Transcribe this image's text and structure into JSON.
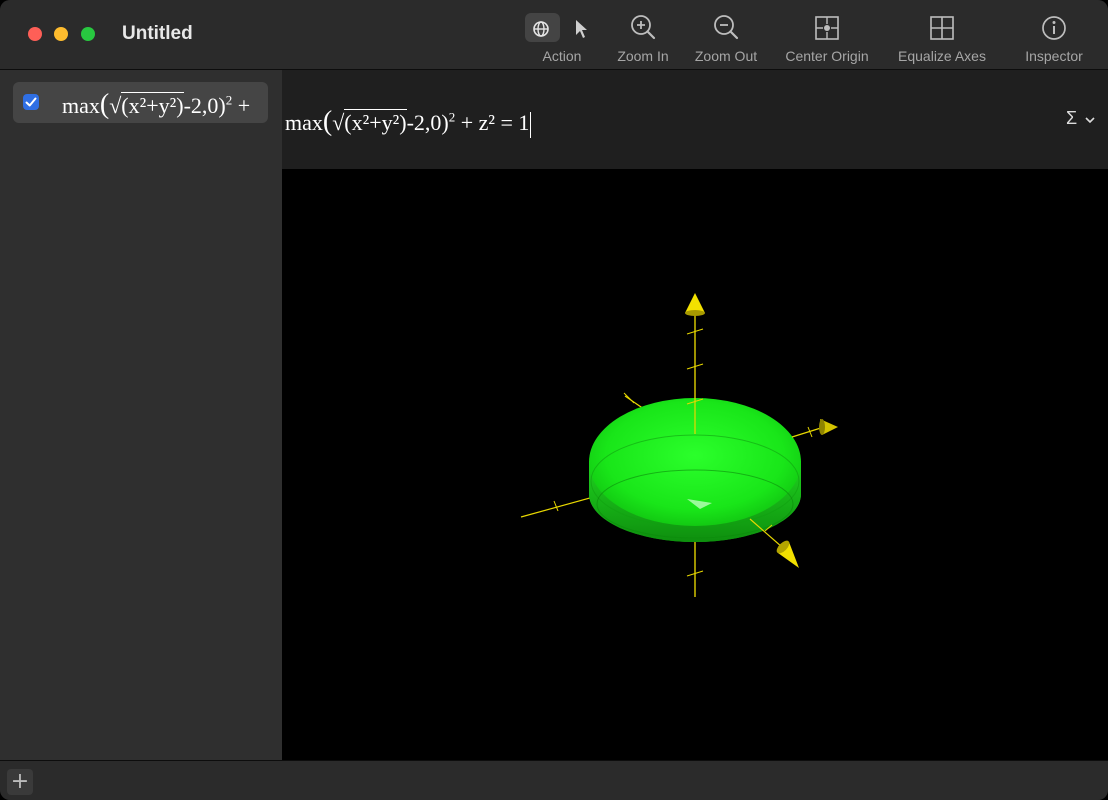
{
  "window": {
    "title": "Untitled"
  },
  "toolbar": {
    "action_label": "Action",
    "zoom_in_label": "Zoom In",
    "zoom_out_label": "Zoom Out",
    "center_origin_label": "Center Origin",
    "equalize_axes_label": "Equalize Axes",
    "inspector_label": "Inspector"
  },
  "sidebar": {
    "items": [
      {
        "checked": true,
        "eq_prefix": "max",
        "eq_under_root": "(x²+y²)",
        "eq_after_root": "-2,0)",
        "eq_tail": " +"
      }
    ]
  },
  "editor": {
    "eq_prefix": "max",
    "eq_under_root": "(x²+y²)",
    "eq_after_root": "-2,0)",
    "eq_tail": " + z² = 1",
    "sigma_icon": "Σ"
  },
  "viewport": {
    "surface_color": "#22ee22",
    "axis_color": "#e8d800"
  },
  "bottom": {
    "add_label": "+"
  }
}
